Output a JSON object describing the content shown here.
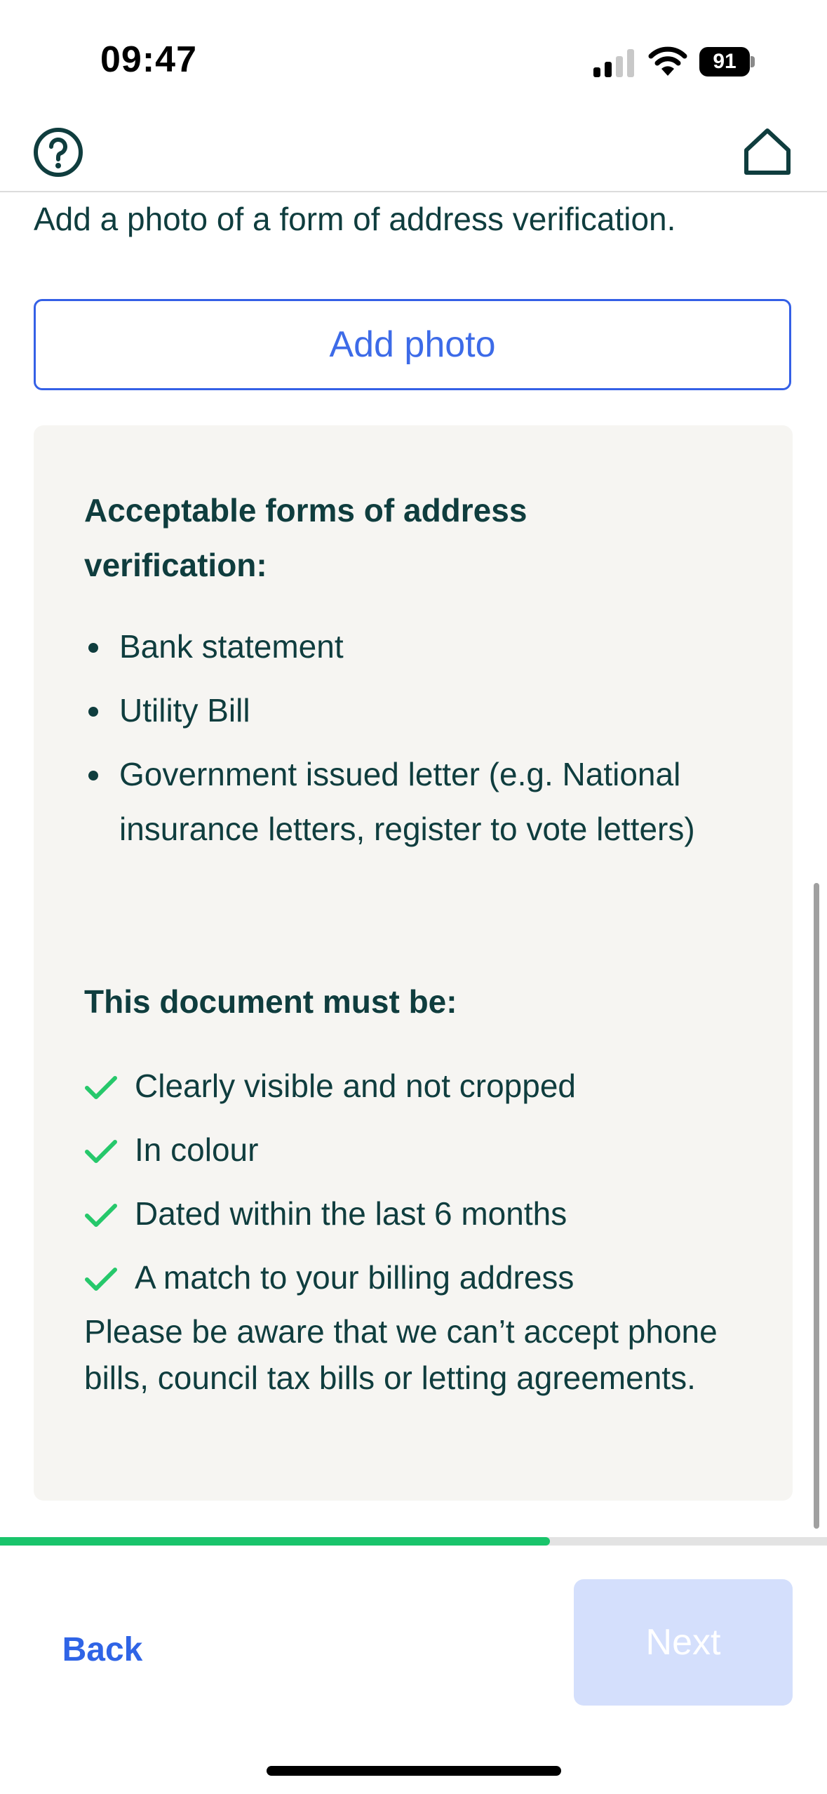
{
  "status_bar": {
    "time": "09:47",
    "battery_level": "91",
    "signal_bars_active": 2,
    "signal_bars_total": 4
  },
  "header": {
    "help_icon": "help-circle-icon",
    "home_icon": "home-icon"
  },
  "main": {
    "intro_text": "Add a photo of a form of address verification.",
    "add_photo_label": "Add photo",
    "info": {
      "acceptable_heading_line1": "Acceptable forms of address",
      "acceptable_heading_line2": "verification:",
      "acceptable_items": [
        "Bank statement",
        "Utility Bill",
        "Government issued letter (e.g. National insurance letters, register to vote letters)"
      ],
      "requirements_heading": "This document must be:",
      "requirements": [
        "Clearly visible and not cropped",
        "In colour",
        "Dated within the last 6 months",
        "A match to your billing address"
      ],
      "note": "Please be aware that we can’t accept phone bills, council tax bills or letting agreements."
    }
  },
  "progress": {
    "fraction": 0.665
  },
  "footer": {
    "back_label": "Back",
    "next_label": "Next",
    "next_enabled": false
  },
  "colors": {
    "text": "#0f3d3e",
    "accent_blue": "#3d6be8",
    "check_green": "#26c86b",
    "progress_green": "#19c46b",
    "card_bg": "#f6f5f2",
    "next_disabled_bg": "#d4dffc"
  }
}
